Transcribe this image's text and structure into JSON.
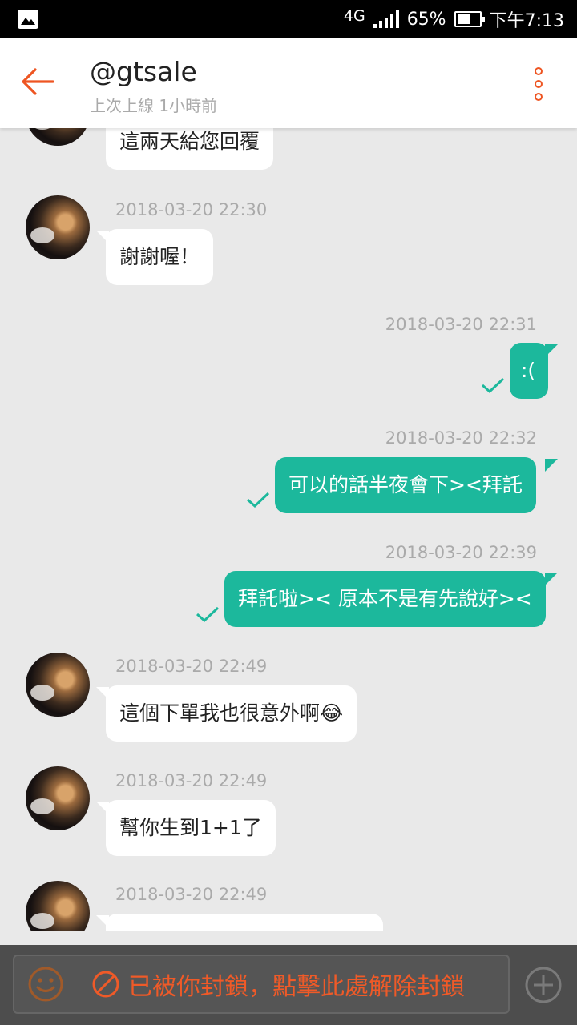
{
  "status_bar": {
    "network": "4G",
    "battery": "65%",
    "battery_level": 0.65,
    "time": "下午7:13",
    "left_icon": "image-icon"
  },
  "header": {
    "title": "@gtsale",
    "subtitle": "上次上線 1小時前",
    "back_icon": "back-arrow-icon",
    "more_icon": "more-vertical-icon",
    "accent": "#ee5522"
  },
  "messages": [
    {
      "side": "in",
      "time": "",
      "text": "這兩天給您回覆"
    },
    {
      "side": "in",
      "time": "2018-03-20 22:30",
      "text": "謝謝喔！"
    },
    {
      "side": "out",
      "time": "2018-03-20 22:31",
      "text": ":("
    },
    {
      "side": "out",
      "time": "2018-03-20 22:32",
      "text": "可以的話半夜會下><拜託"
    },
    {
      "side": "out",
      "time": "2018-03-20 22:39",
      "text": "拜託啦>< 原本不是有先說好><"
    },
    {
      "side": "in",
      "time": "2018-03-20 22:49",
      "text": "這個下單我也很意外啊😂"
    },
    {
      "side": "in",
      "time": "2018-03-20 22:49",
      "text": "幫你生到1+1了"
    },
    {
      "side": "in",
      "time": "2018-03-20 22:49",
      "text": ""
    }
  ],
  "colors": {
    "outgoing_bubble": "#1cb89c",
    "incoming_bubble": "#ffffff",
    "background": "#e9e9e9"
  },
  "bottom_bar": {
    "blocked_text": "已被你封鎖，點擊此處解除封鎖",
    "emoji_icon": "smiley-icon",
    "ban_icon": "ban-icon",
    "add_icon": "plus-circle-icon"
  }
}
